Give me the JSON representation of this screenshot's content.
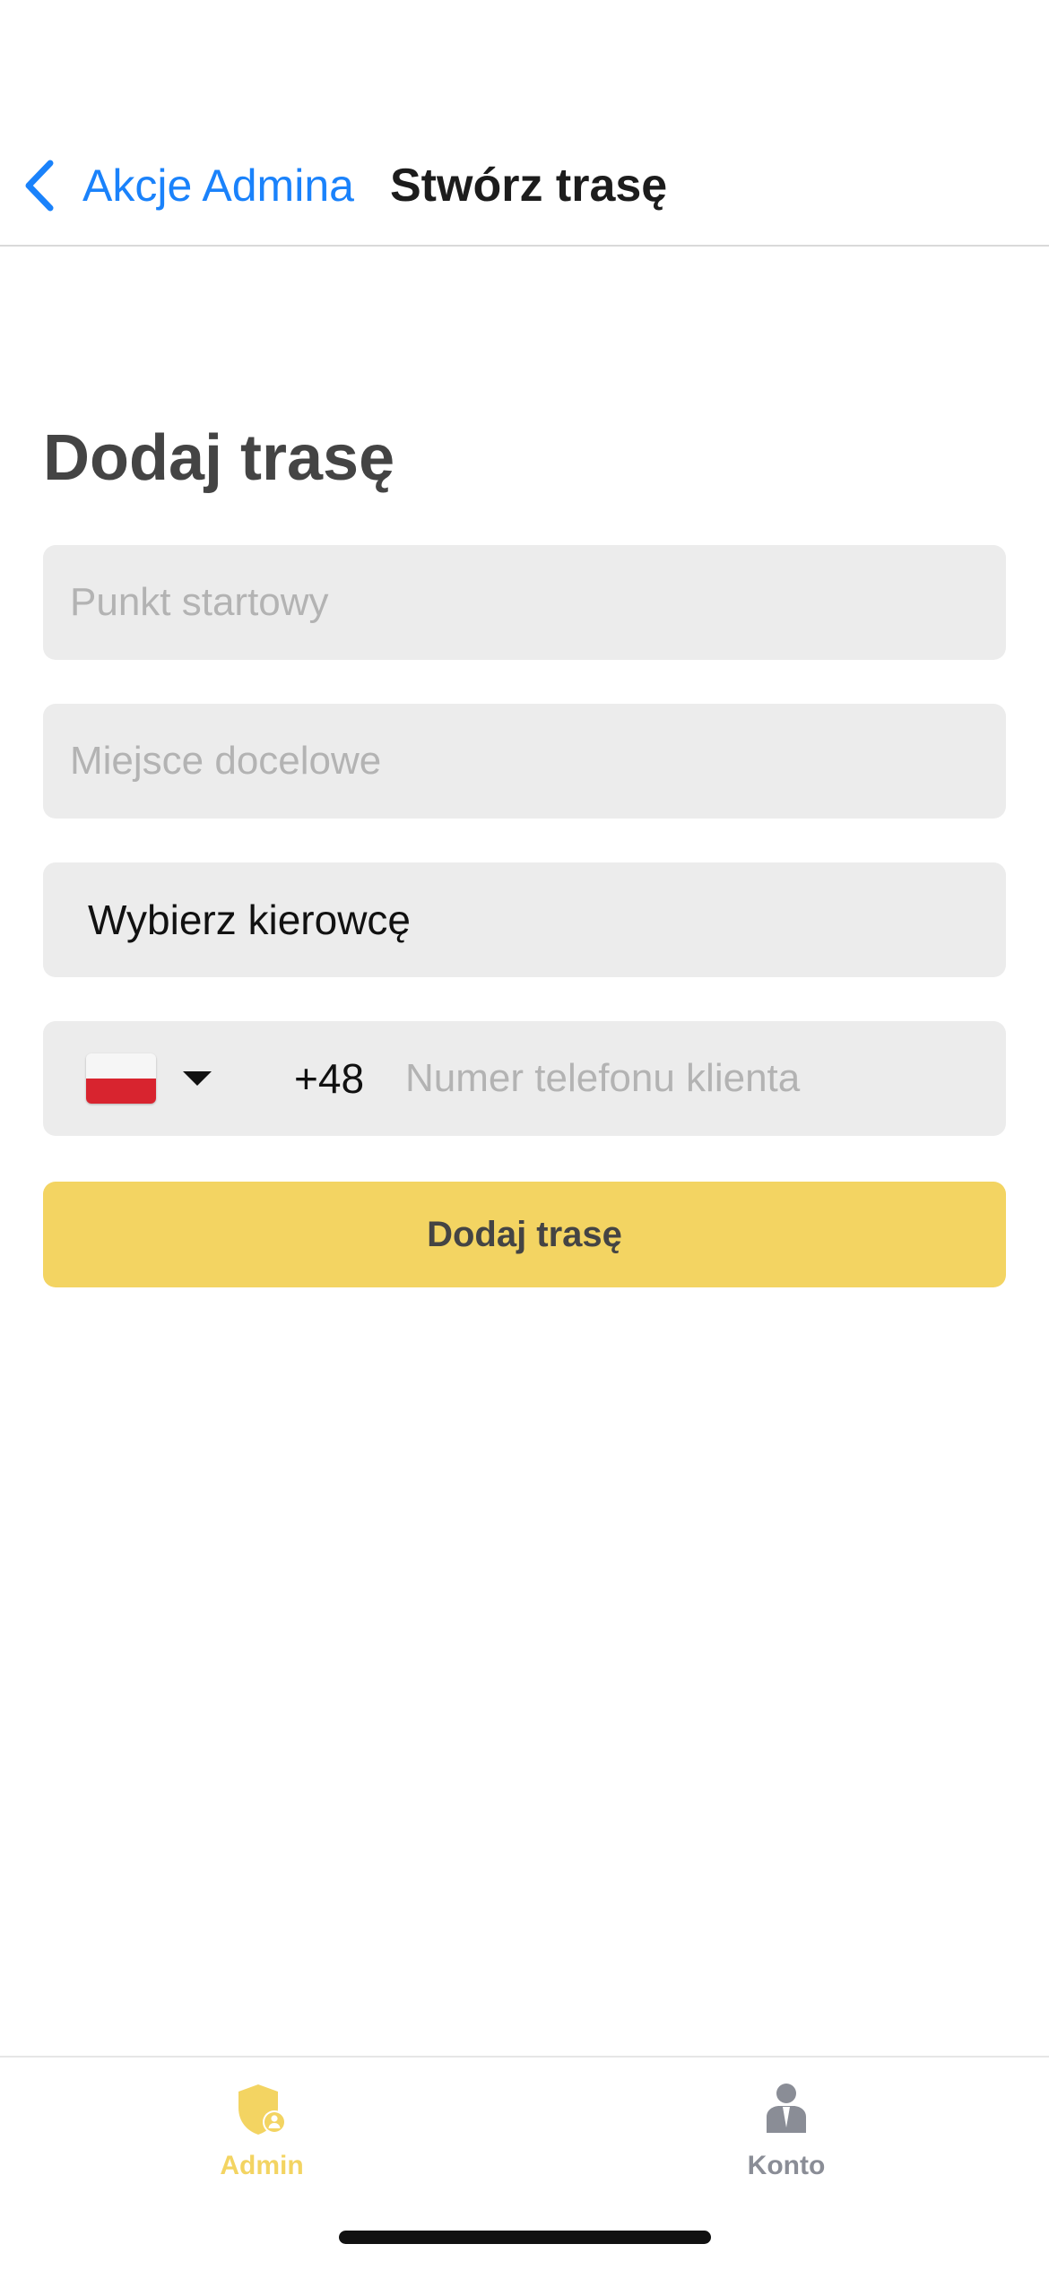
{
  "nav": {
    "back_label": "Akcje Admina",
    "title": "Stwórz trasę"
  },
  "form": {
    "heading": "Dodaj trasę",
    "start_placeholder": "Punkt startowy",
    "destination_placeholder": "Miejsce docelowe",
    "driver_select_label": "Wybierz kierowcę",
    "phone": {
      "country_flag": "poland-flag-icon",
      "dial_code": "+48",
      "placeholder": "Numer telefonu klienta"
    },
    "submit_label": "Dodaj trasę"
  },
  "tabs": [
    {
      "label": "Admin",
      "icon": "admin-shield-icon",
      "active": true
    },
    {
      "label": "Konto",
      "icon": "account-person-icon",
      "active": false
    }
  ],
  "colors": {
    "accent": "#f3d462",
    "link": "#1a82fb",
    "field_bg": "#ececec",
    "inactive_tab": "#8a8d96"
  }
}
